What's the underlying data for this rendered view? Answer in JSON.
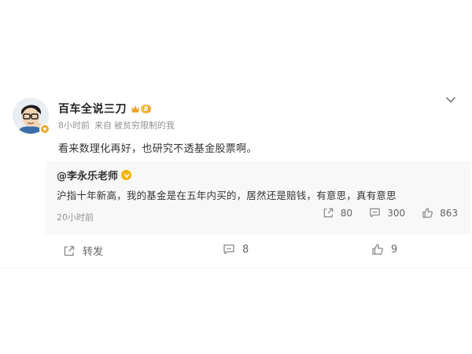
{
  "post": {
    "author": {
      "name": "百车全说三刀",
      "vip_level": "Ⅱ",
      "avatar_icon": "cartoon-avatar-icon"
    },
    "meta": {
      "time": "8小时前",
      "source_prefix": "来自",
      "source": "被贫穷限制的我"
    },
    "text": "看来数理化再好，也研究不透基金股票啊。",
    "repost": {
      "author": "@李永乐老师",
      "text": "沪指十年新高，我的基金是在五年内买的，居然还是赔钱，有意思，真有意思",
      "time": "20小时前",
      "actions": {
        "reposts": "80",
        "comments": "300",
        "likes": "863"
      }
    },
    "actions": {
      "forward_label": "转发",
      "comments": "8",
      "likes": "9"
    }
  },
  "colors": {
    "meta_gray": "#939393",
    "repost_bg": "#f8f8f8",
    "vip_gold": "#f5a623"
  }
}
